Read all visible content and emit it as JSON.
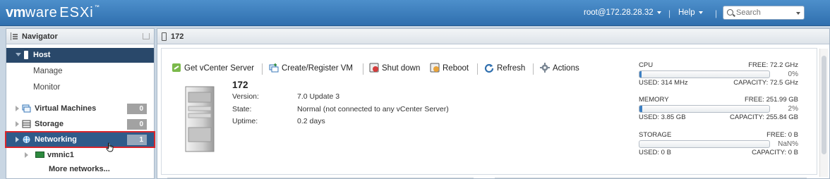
{
  "header": {
    "logo_vm": "vm",
    "logo_ware": "ware",
    "logo_product": "ESXi",
    "logo_tm": "™",
    "user": "root@172.28.28.32",
    "help": "Help",
    "search_placeholder": "Search",
    "separator": "|"
  },
  "navigator": {
    "title": "Navigator",
    "host_label": "Host",
    "host_sub": [
      "Manage",
      "Monitor"
    ],
    "groups": [
      {
        "label": "Virtual Machines",
        "count": "0"
      },
      {
        "label": "Storage",
        "count": "0"
      },
      {
        "label": "Networking",
        "count": "1"
      }
    ],
    "vmnic": "vmnic1",
    "more": "More networks..."
  },
  "main": {
    "tab_title": "172",
    "toolbar": {
      "get_vcenter": "Get vCenter Server",
      "create_register": "Create/Register VM",
      "shut_down": "Shut down",
      "reboot": "Reboot",
      "refresh": "Refresh",
      "actions": "Actions"
    },
    "hostname": "172",
    "details": {
      "version_label": "Version:",
      "version_value": "7.0 Update 3",
      "state_label": "State:",
      "state_value": "Normal (not connected to any vCenter Server)",
      "uptime_label": "Uptime:",
      "uptime_value": "0.2 days"
    },
    "resources": {
      "cpu": {
        "label": "CPU",
        "free": "FREE: 72.2 GHz",
        "pct": "0%",
        "used": "USED: 314 MHz",
        "capacity": "CAPACITY: 72.5 GHz",
        "fill": 0.004
      },
      "memory": {
        "label": "MEMORY",
        "free": "FREE: 251.99 GB",
        "pct": "2%",
        "used": "USED: 3.85 GB",
        "capacity": "CAPACITY: 255.84 GB",
        "fill": 0.02
      },
      "storage": {
        "label": "STORAGE",
        "free": "FREE: 0 B",
        "pct": "NaN%",
        "used": "USED: 0 B",
        "capacity": "CAPACITY: 0 B",
        "fill": 0
      }
    }
  },
  "colors": {
    "topbar": "#3a7cbd",
    "selection": "#29486a",
    "highlight_outline": "#d9262c",
    "bar_fill": "#3c7fc2"
  }
}
